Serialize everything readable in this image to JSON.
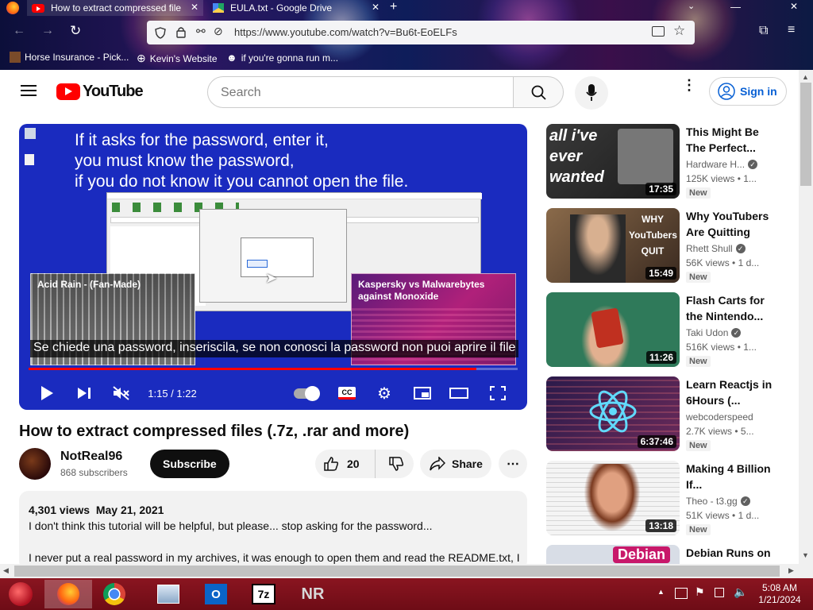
{
  "browser": {
    "tabs": [
      {
        "title": "How to extract compressed file"
      },
      {
        "title": "EULA.txt - Google Drive"
      }
    ],
    "url": "https://www.youtube.com/watch?v=Bu6t-EoELFs",
    "bookmarks": [
      {
        "label": "Horse Insurance - Pick..."
      },
      {
        "label": "Kevin's Website"
      },
      {
        "label": "if you're gonna run m..."
      }
    ]
  },
  "youtube": {
    "logo_text": "YouTube",
    "search_placeholder": "Search",
    "sign_in": "Sign in"
  },
  "player": {
    "overlay_line1": "If it asks for the password, enter it,",
    "overlay_line2": "you must know the password,",
    "overlay_line3": "if you do not know it you cannot open the file.",
    "endcard_left": "Acid Rain - (Fan-Made)",
    "endcard_right": "Kaspersky vs Malwarebytes against Monoxide",
    "subtitle": "Se chiede una password, inseriscila, se non conosci la password non puoi aprire il file",
    "time": "1:15 / 1:22",
    "progress": 0.915
  },
  "video": {
    "title": "How to extract compressed files (.7z, .rar and more)",
    "channel": "NotReal96",
    "subscribers": "868 subscribers",
    "subscribe": "Subscribe",
    "likes": "20",
    "share": "Share",
    "views": "4,301 views",
    "date": "May 21, 2021",
    "desc_line1": "I don't think this tutorial will be helpful, but please... stop asking for the password...",
    "desc_line2": "I never put a real password in my archives, it was enough to open them and read the README.txt, I"
  },
  "recommendations": [
    {
      "title": "This Might Be The Perfect...",
      "channel": "Hardware H...",
      "verified": true,
      "views": "125K views",
      "age": "1...",
      "new": "New",
      "duration": "17:35",
      "thumb_text": "all i've ever wanted",
      "thumb_color": "#2b2b2b"
    },
    {
      "title": "Why YouTubers Are Quitting",
      "channel": "Rhett Shull",
      "verified": true,
      "views": "56K views",
      "age": "1 d...",
      "new": "New",
      "duration": "15:49",
      "thumb_text": "WHY YouTubers QUIT",
      "thumb_color": "#7a5a40"
    },
    {
      "title": "Flash Carts for the Nintendo...",
      "channel": "Taki Udon",
      "verified": true,
      "views": "516K views",
      "age": "1...",
      "new": "New",
      "duration": "11:26",
      "thumb_text": "",
      "thumb_color": "#2f7a5a"
    },
    {
      "title": "Learn Reactjs in 6Hours (...",
      "channel": "webcoderspeed",
      "verified": false,
      "views": "2.7K views",
      "age": "5...",
      "new": "New",
      "duration": "6:37:46",
      "thumb_text": "",
      "thumb_color": "#3a1a5a"
    },
    {
      "title": "Making 4 Billion If...",
      "channel": "Theo - t3.gg",
      "verified": true,
      "views": "51K views",
      "age": "1 d...",
      "new": "New",
      "duration": "13:18",
      "thumb_text": "",
      "thumb_color": "#e9e9e9"
    },
    {
      "title": "Debian Runs on",
      "channel": "",
      "verified": false,
      "views": "",
      "age": "",
      "new": "",
      "duration": "",
      "thumb_text": "Debian",
      "thumb_color": "#d8dde6"
    }
  ],
  "taskbar": {
    "time": "5:08 AM",
    "date": "1/21/2024",
    "apps": [
      "firefox",
      "chrome",
      "explorer",
      "outlook",
      "7z",
      "NR"
    ],
    "seven_zip_label": "7z",
    "nr_label": "NR"
  },
  "colors": {
    "yt_red": "#ff0000",
    "link_blue": "#065fd4",
    "player_blue": "#1a2bbf",
    "taskbar_red": "#7a1019"
  }
}
